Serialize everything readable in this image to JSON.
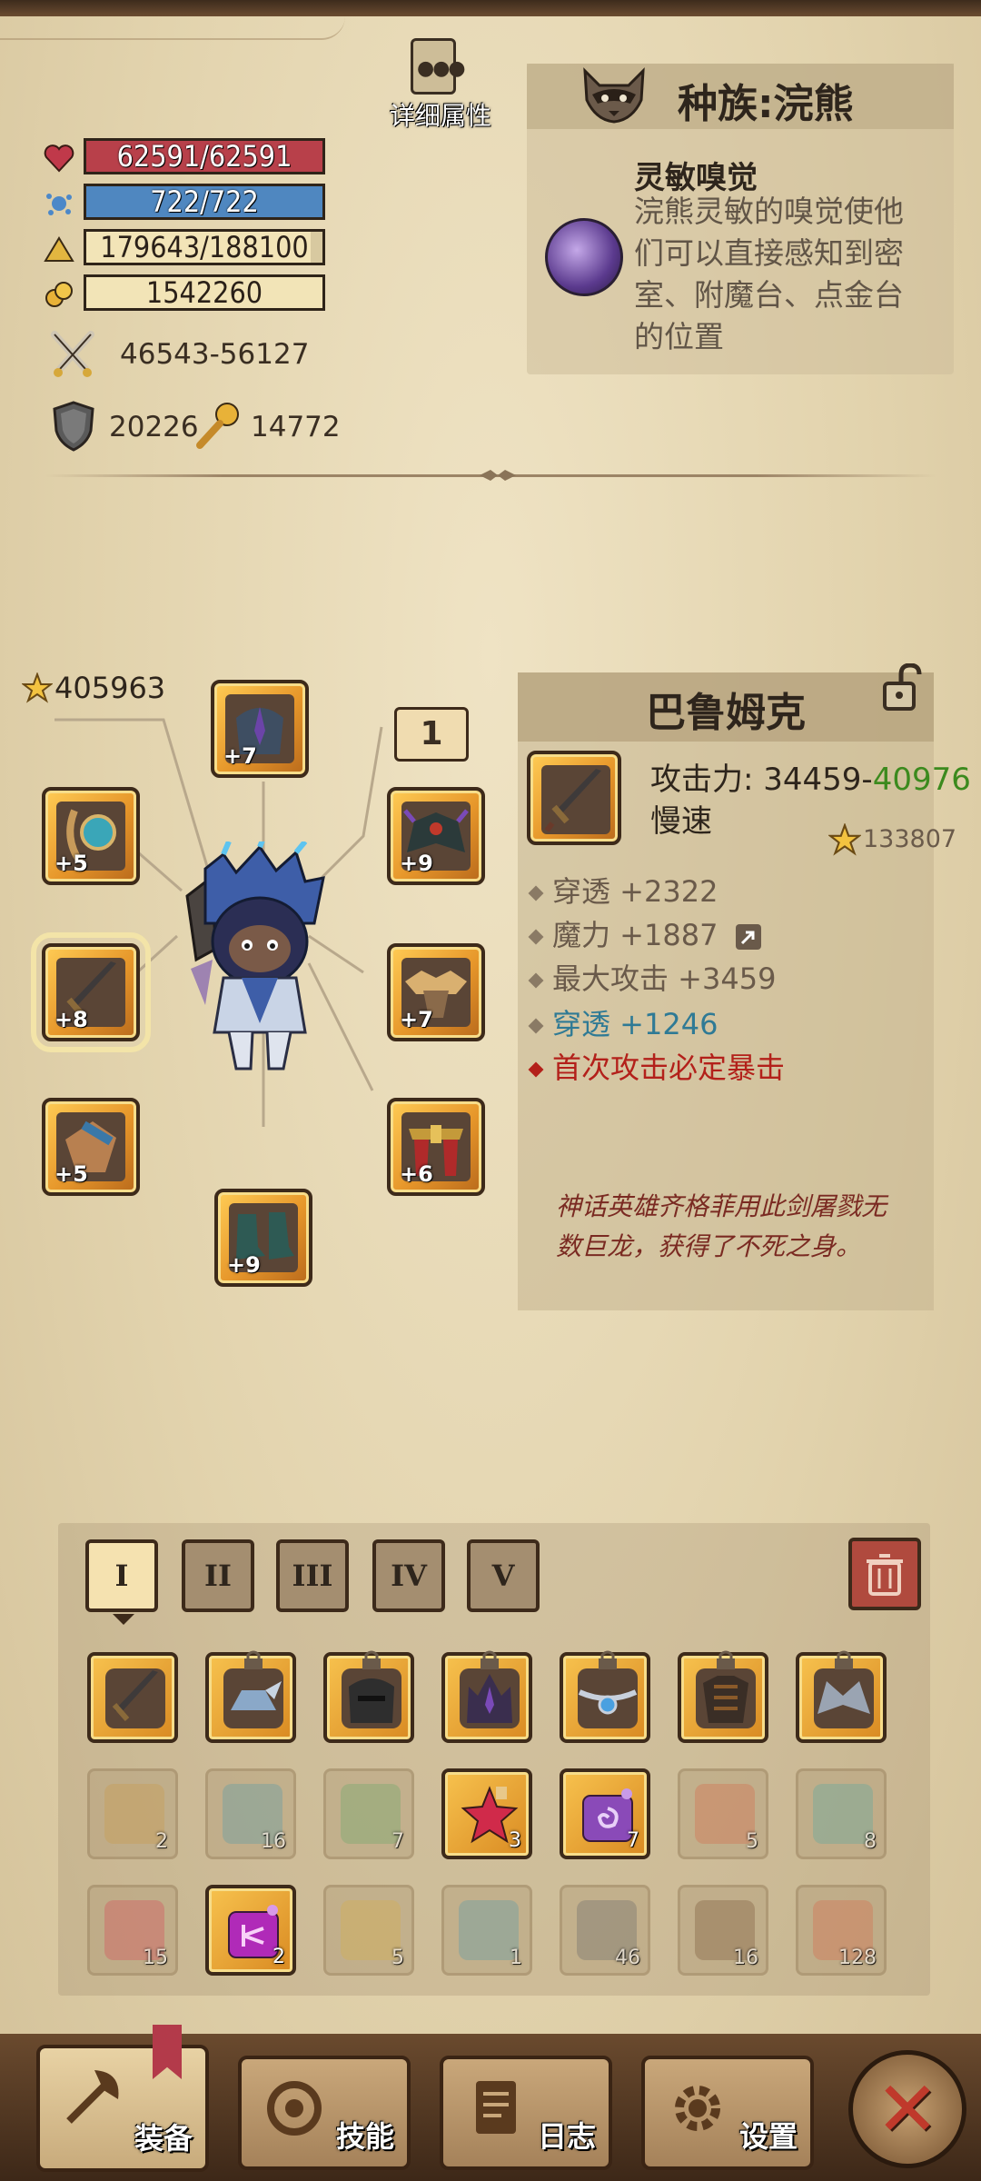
{
  "stats": {
    "hp": "62591/62591",
    "mp": "722/722",
    "xp": "179643/188100",
    "xp_fraction": 0.955,
    "gold": "1542260",
    "attack": "46543-56127",
    "defense": "20226",
    "magic": "14772"
  },
  "detail_label": "详细属性",
  "race": {
    "title": "种族:浣熊",
    "skill_name": "灵敏嗅觉",
    "skill_desc": "浣熊灵敏的嗅觉使他们可以直接感知到密室、附魔台、点金台的位置"
  },
  "equipment": {
    "total_score": "405963",
    "tier_badge": "1",
    "slots": [
      {
        "name": "helmet",
        "level": "+7"
      },
      {
        "name": "amulet",
        "level": "+5"
      },
      {
        "name": "shoulder",
        "level": "+9"
      },
      {
        "name": "weapon",
        "level": "+8"
      },
      {
        "name": "chest",
        "level": "+7"
      },
      {
        "name": "gloves",
        "level": "+5"
      },
      {
        "name": "belt",
        "level": "+6"
      },
      {
        "name": "boots",
        "level": "+9"
      }
    ]
  },
  "item": {
    "name": "巴鲁姆克",
    "attack_label": "攻击力: 34459-",
    "attack_max": "40976",
    "speed": "慢速",
    "score": "133807",
    "affixes": [
      {
        "text": "穿透 +2322",
        "style": "normal"
      },
      {
        "text": "魔力 +1887",
        "style": "normal"
      },
      {
        "text": "最大攻击 +3459",
        "style": "normal"
      },
      {
        "text": "穿透 +1246",
        "style": "blue"
      },
      {
        "text": "首次攻击必定暴击",
        "style": "red"
      }
    ],
    "lore": "神话英雄齐格菲用此剑屠戮无数巨龙，获得了不死之身。"
  },
  "inventory": {
    "tabs": [
      "I",
      "II",
      "III",
      "IV",
      "V"
    ],
    "active_tab": "I",
    "row1": [
      "weapon",
      "winged-helm",
      "dark-helm",
      "crown-helm",
      "silver-amulet",
      "beast-armor",
      "wing-shoulder"
    ],
    "row2_counts": [
      "2",
      "16",
      "7",
      "3",
      "7",
      "5",
      "8"
    ],
    "row3_counts": [
      "15",
      "2",
      "5",
      "1",
      "46",
      "16",
      "128"
    ]
  },
  "nav": {
    "equip": "装备",
    "skills": "技能",
    "log": "日志",
    "settings": "设置"
  },
  "colors": {
    "hp": "#b8404a",
    "mp": "#4f87c0",
    "rare_green": "#3c8a1e",
    "affix_blue": "#2f7a95",
    "affix_red": "#b3201a"
  }
}
